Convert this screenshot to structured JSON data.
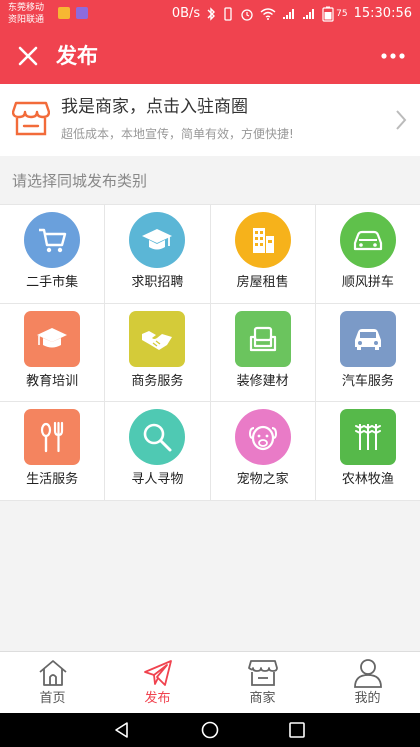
{
  "status_bar": {
    "carrier_line1": "东莞移动",
    "carrier_line2": "资阳联通",
    "speed": "0B/s",
    "battery": "75",
    "time": "15:30:56"
  },
  "header": {
    "title": "发布"
  },
  "merchant_banner": {
    "title": "我是商家，点击入驻商圈",
    "subtitle": "超低成本，本地宣传，简单有效，方便快捷!"
  },
  "section": {
    "label": "请选择同城发布类别"
  },
  "categories": [
    {
      "label": "二手市集",
      "icon": "shopping-cart-icon",
      "color": "#6aa0dc"
    },
    {
      "label": "求职招聘",
      "icon": "graduation-cap-icon",
      "color": "#5bb6d6"
    },
    {
      "label": "房屋租售",
      "icon": "building-icon",
      "color": "#f6b21b"
    },
    {
      "label": "顺风拼车",
      "icon": "car-icon",
      "color": "#5fc14b"
    },
    {
      "label": "教育培训",
      "icon": "mortarboard-icon",
      "color": "#f4845f"
    },
    {
      "label": "商务服务",
      "icon": "handshake-icon",
      "color": "#d4cb39"
    },
    {
      "label": "装修建材",
      "icon": "sofa-icon",
      "color": "#6bc45e"
    },
    {
      "label": "汽车服务",
      "icon": "car-front-icon",
      "color": "#7b9ac7"
    },
    {
      "label": "生活服务",
      "icon": "spoon-fork-icon",
      "color": "#f4845f"
    },
    {
      "label": "寻人寻物",
      "icon": "magnifier-icon",
      "color": "#4fc9b3"
    },
    {
      "label": "宠物之家",
      "icon": "dog-icon",
      "color": "#e97bc7"
    },
    {
      "label": "农林牧渔",
      "icon": "wheat-icon",
      "color": "#56b94a"
    }
  ],
  "tabbar": {
    "items": [
      {
        "label": "首页",
        "icon": "home-icon"
      },
      {
        "label": "发布",
        "icon": "paper-plane-icon"
      },
      {
        "label": "商家",
        "icon": "store-icon"
      },
      {
        "label": "我的",
        "icon": "user-icon"
      }
    ]
  },
  "colors": {
    "brand": "#f0434f",
    "text": "#222222",
    "muted": "#999999"
  }
}
